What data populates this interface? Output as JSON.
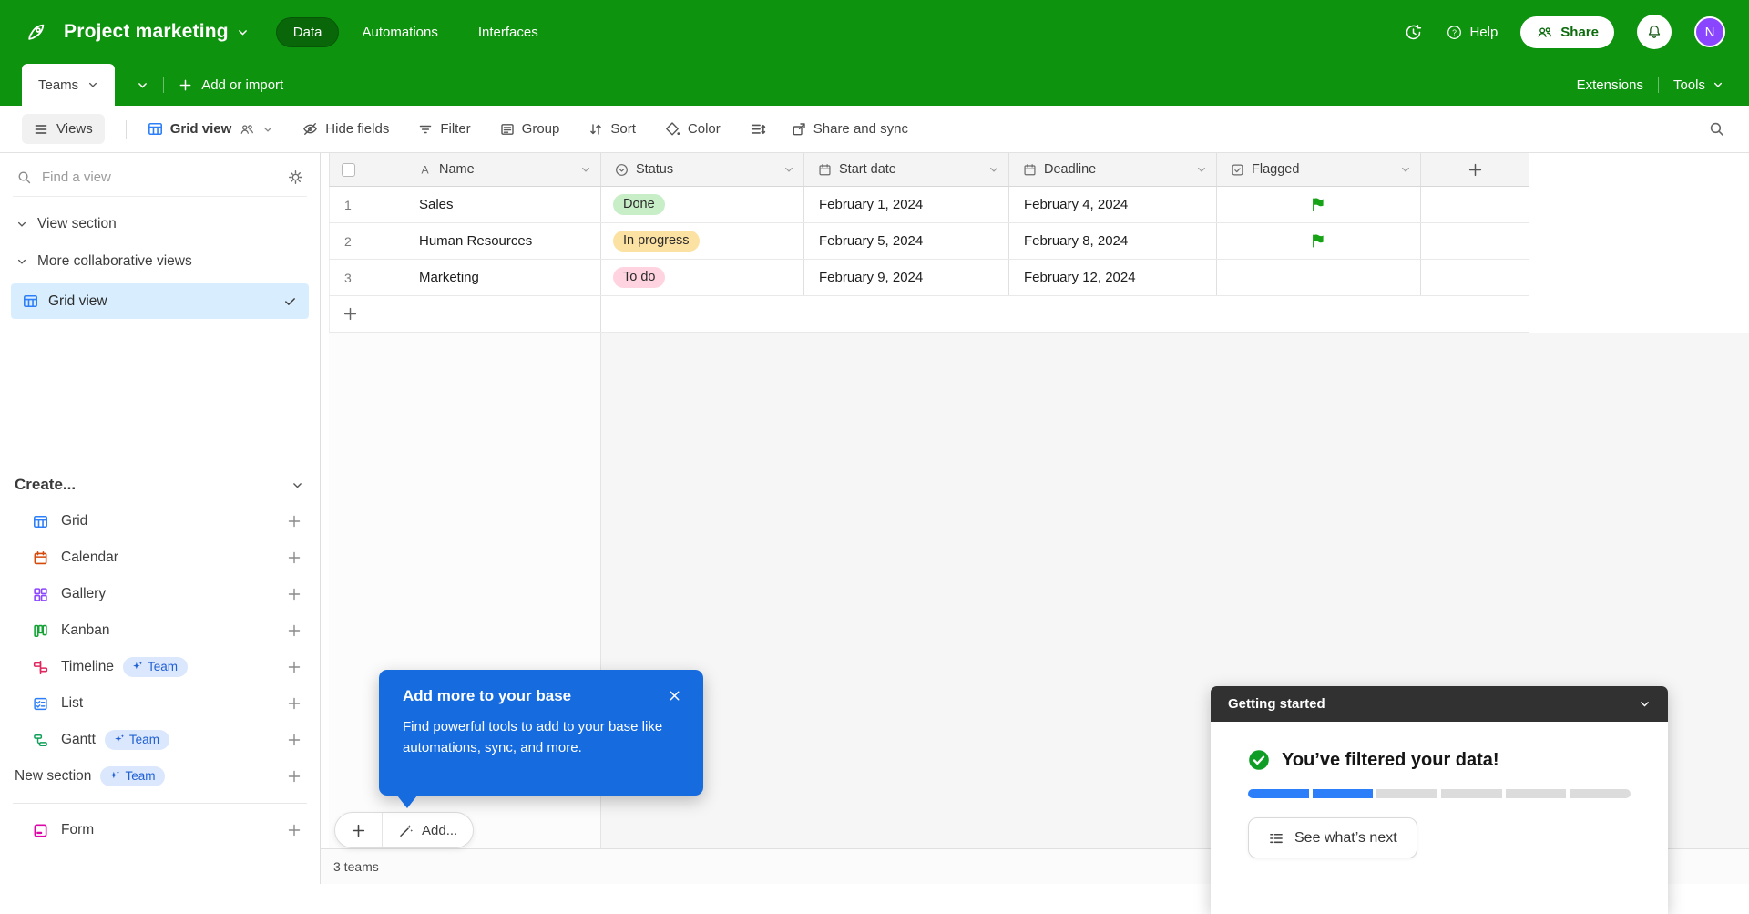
{
  "colors": {
    "brand-green": "#0d930d",
    "accent-blue": "#2d7ff9",
    "selection-blue": "#d8eefe",
    "popup-blue": "#166bdf",
    "flag-green": "#16a316",
    "success-green": "#0f9d25",
    "avatar-purple": "#8a46ff",
    "team-badge-bg": "#dbe7fd",
    "team-badge-text": "#2160d3"
  },
  "topbar": {
    "base_name": "Project marketing",
    "tabs": [
      {
        "label": "Data",
        "active": true
      },
      {
        "label": "Automations",
        "active": false
      },
      {
        "label": "Interfaces",
        "active": false
      }
    ],
    "help_label": "Help",
    "share_label": "Share",
    "avatar_initial": "N"
  },
  "table_bar": {
    "active_table": "Teams",
    "add_or_import": "Add or import",
    "extensions": "Extensions",
    "tools": "Tools"
  },
  "toolbar": {
    "views": "Views",
    "view_name": "Grid view",
    "hide_fields": "Hide fields",
    "filter": "Filter",
    "group": "Group",
    "sort": "Sort",
    "color": "Color",
    "share_and_sync": "Share and sync"
  },
  "sidebar": {
    "find_placeholder": "Find a view",
    "section1": "View section",
    "section2": "More collaborative views",
    "selected_view": "Grid view",
    "create_label": "Create...",
    "create_items": [
      {
        "label": "Grid",
        "badge": null
      },
      {
        "label": "Calendar",
        "badge": null
      },
      {
        "label": "Gallery",
        "badge": null
      },
      {
        "label": "Kanban",
        "badge": null
      },
      {
        "label": "Timeline",
        "badge": "Team"
      },
      {
        "label": "List",
        "badge": null
      },
      {
        "label": "Gantt",
        "badge": "Team"
      },
      {
        "label": "New section",
        "badge": "Team"
      },
      {
        "label": "Form",
        "badge": null
      }
    ]
  },
  "grid": {
    "columns": [
      {
        "name": "Name"
      },
      {
        "name": "Status"
      },
      {
        "name": "Start date"
      },
      {
        "name": "Deadline"
      },
      {
        "name": "Flagged"
      }
    ],
    "rows": [
      {
        "num": "1",
        "name": "Sales",
        "status": "Done",
        "status_color": "#c8eec8",
        "start_date": "February 1, 2024",
        "deadline": "February 4, 2024",
        "flagged": true
      },
      {
        "num": "2",
        "name": "Human Resources",
        "status": "In progress",
        "status_color": "#fce2a2",
        "start_date": "February 5, 2024",
        "deadline": "February 8, 2024",
        "flagged": true
      },
      {
        "num": "3",
        "name": "Marketing",
        "status": "To do",
        "status_color": "#ffd4e0",
        "start_date": "February 9, 2024",
        "deadline": "February 12, 2024",
        "flagged": false
      }
    ],
    "record_count": "3 teams"
  },
  "footer": {
    "add_label": "Add..."
  },
  "popup": {
    "title": "Add more to your base",
    "body": "Find powerful tools to add to your base like automations, sync, and more."
  },
  "getting_started": {
    "title": "Getting started",
    "message": "You’ve filtered your data!",
    "progress_total": 6,
    "progress_done": 2,
    "cta": "See what’s next"
  }
}
